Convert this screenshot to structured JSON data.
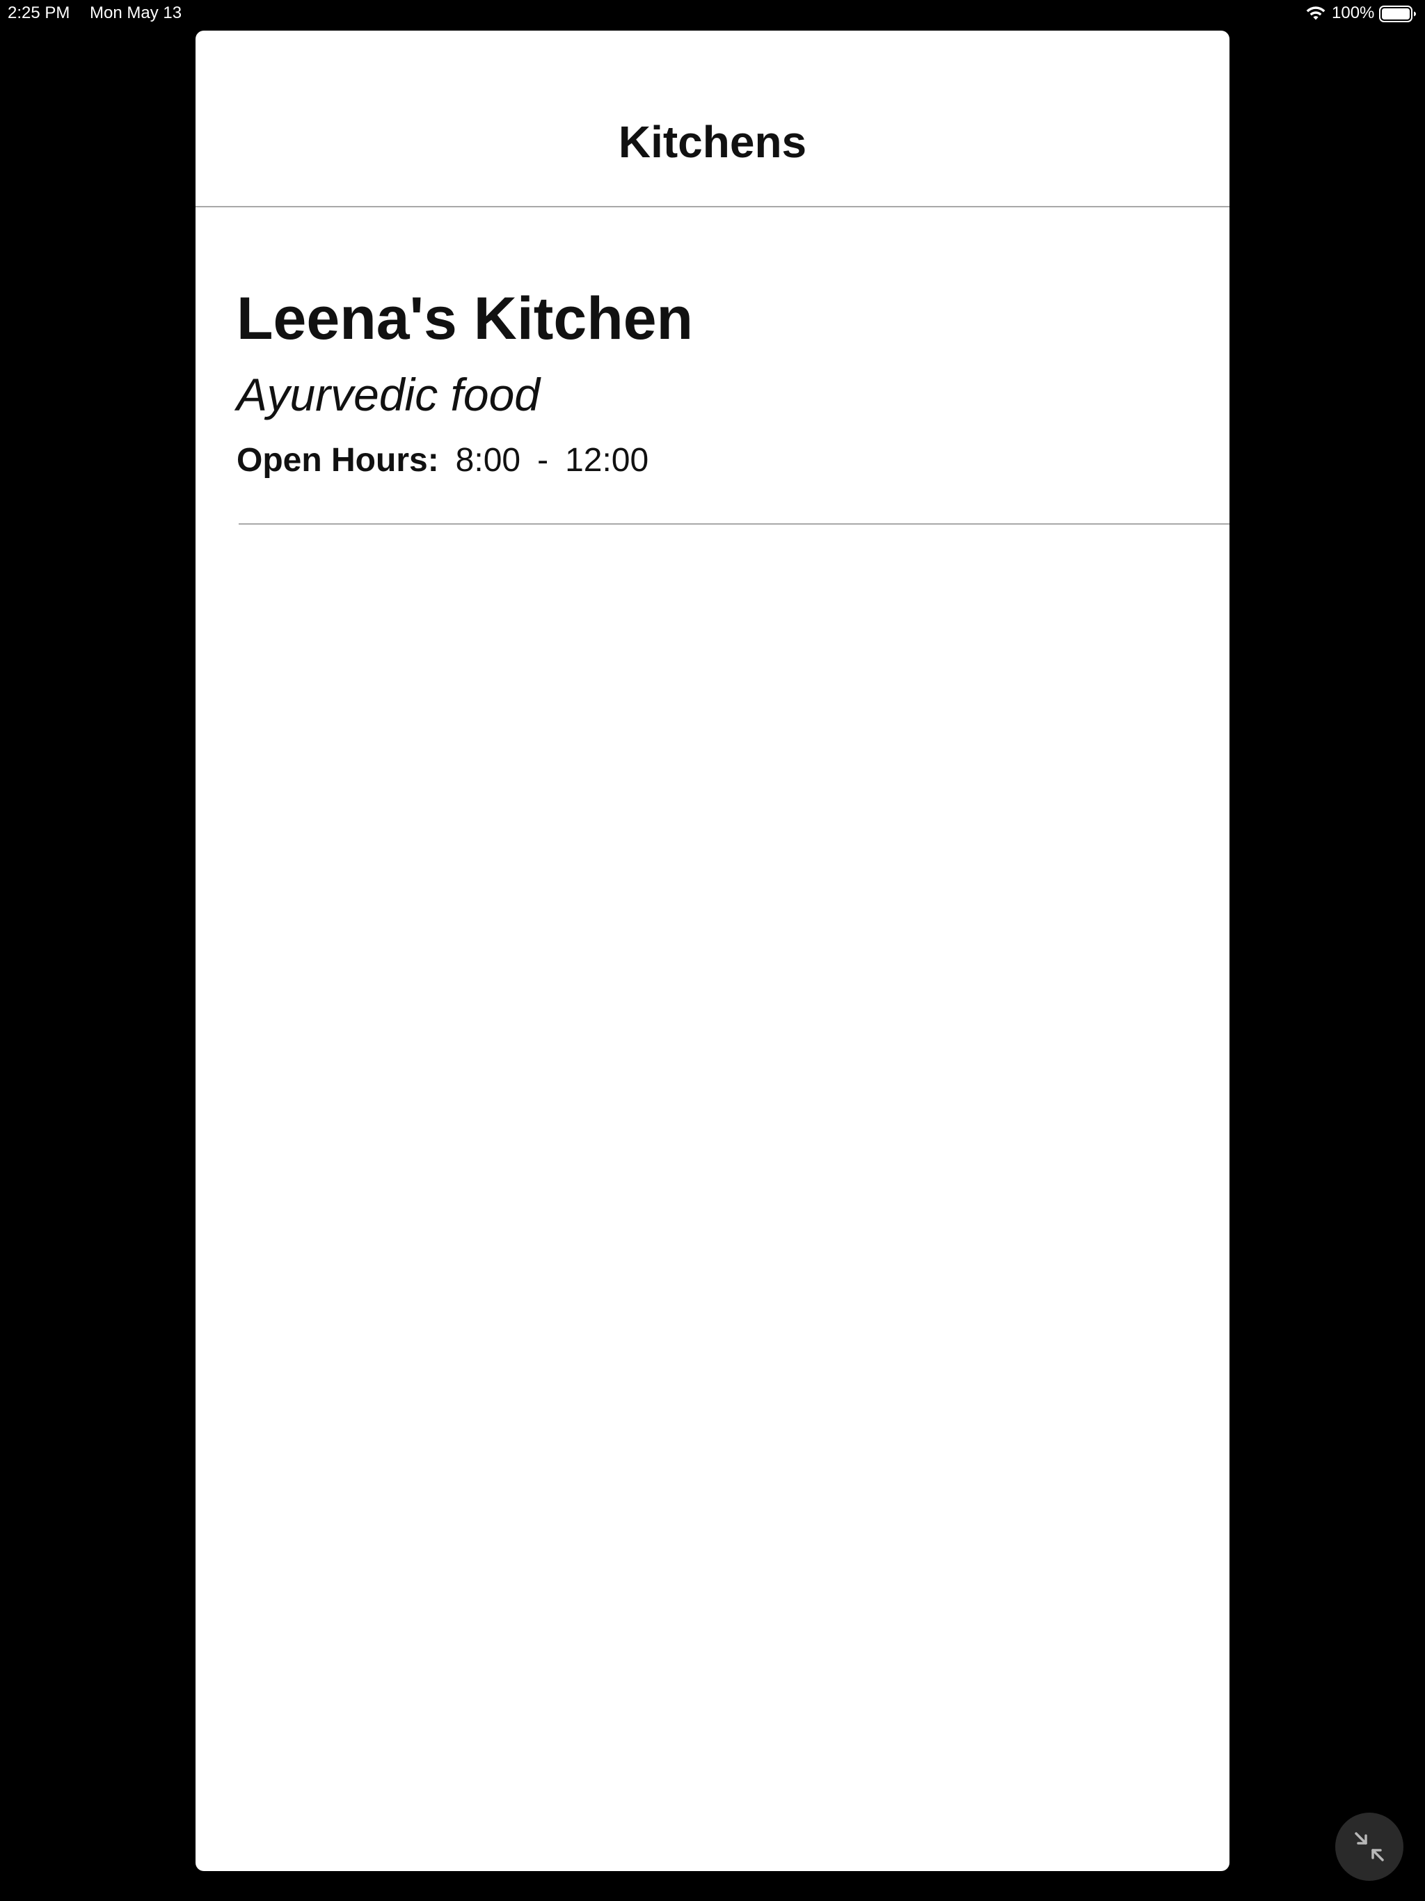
{
  "status_bar": {
    "time": "2:25 PM",
    "date": "Mon May 13",
    "battery_percent": "100%",
    "battery_level": 1.0,
    "icons": [
      "wifi-icon",
      "battery-icon"
    ]
  },
  "nav": {
    "title": "Kitchens"
  },
  "kitchens": [
    {
      "name": "Leena's Kitchen",
      "cuisine": "Ayurvedic food",
      "hours_label": "Open Hours:",
      "open": "8:00",
      "separator": "-",
      "close": "12:00"
    }
  ],
  "floating_button": {
    "icon": "exit-fullscreen-icon"
  },
  "colors": {
    "background": "#000000",
    "surface": "#ffffff",
    "text": "#111111",
    "divider": "#a8a8a8",
    "floating_button": "#2a2a2a"
  }
}
